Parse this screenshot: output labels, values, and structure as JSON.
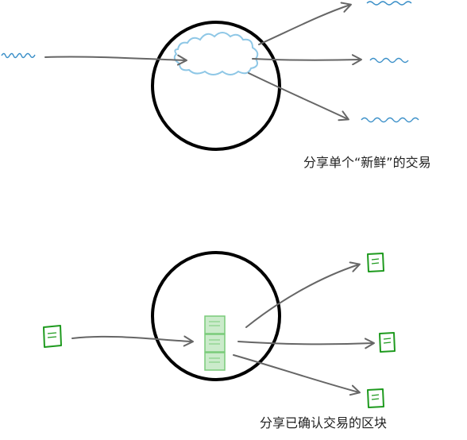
{
  "panels": {
    "top": {
      "caption": "分享单个“新鲜”的交易"
    },
    "bottom": {
      "caption": "分享已确认交易的区块"
    }
  },
  "colors": {
    "circle": "#000000",
    "arrow": "#666666",
    "transaction_squiggle": "#3a8fc8",
    "mempool_cloud": "#8ec7e6",
    "block_outline": "#1e9a1e",
    "block_stack_fill": "#b5e3b5",
    "block_stack_stroke": "#7acb7a"
  },
  "icons": {
    "transaction": "squiggle-line-icon",
    "mempool": "cloud-icon",
    "block": "document-icon"
  }
}
